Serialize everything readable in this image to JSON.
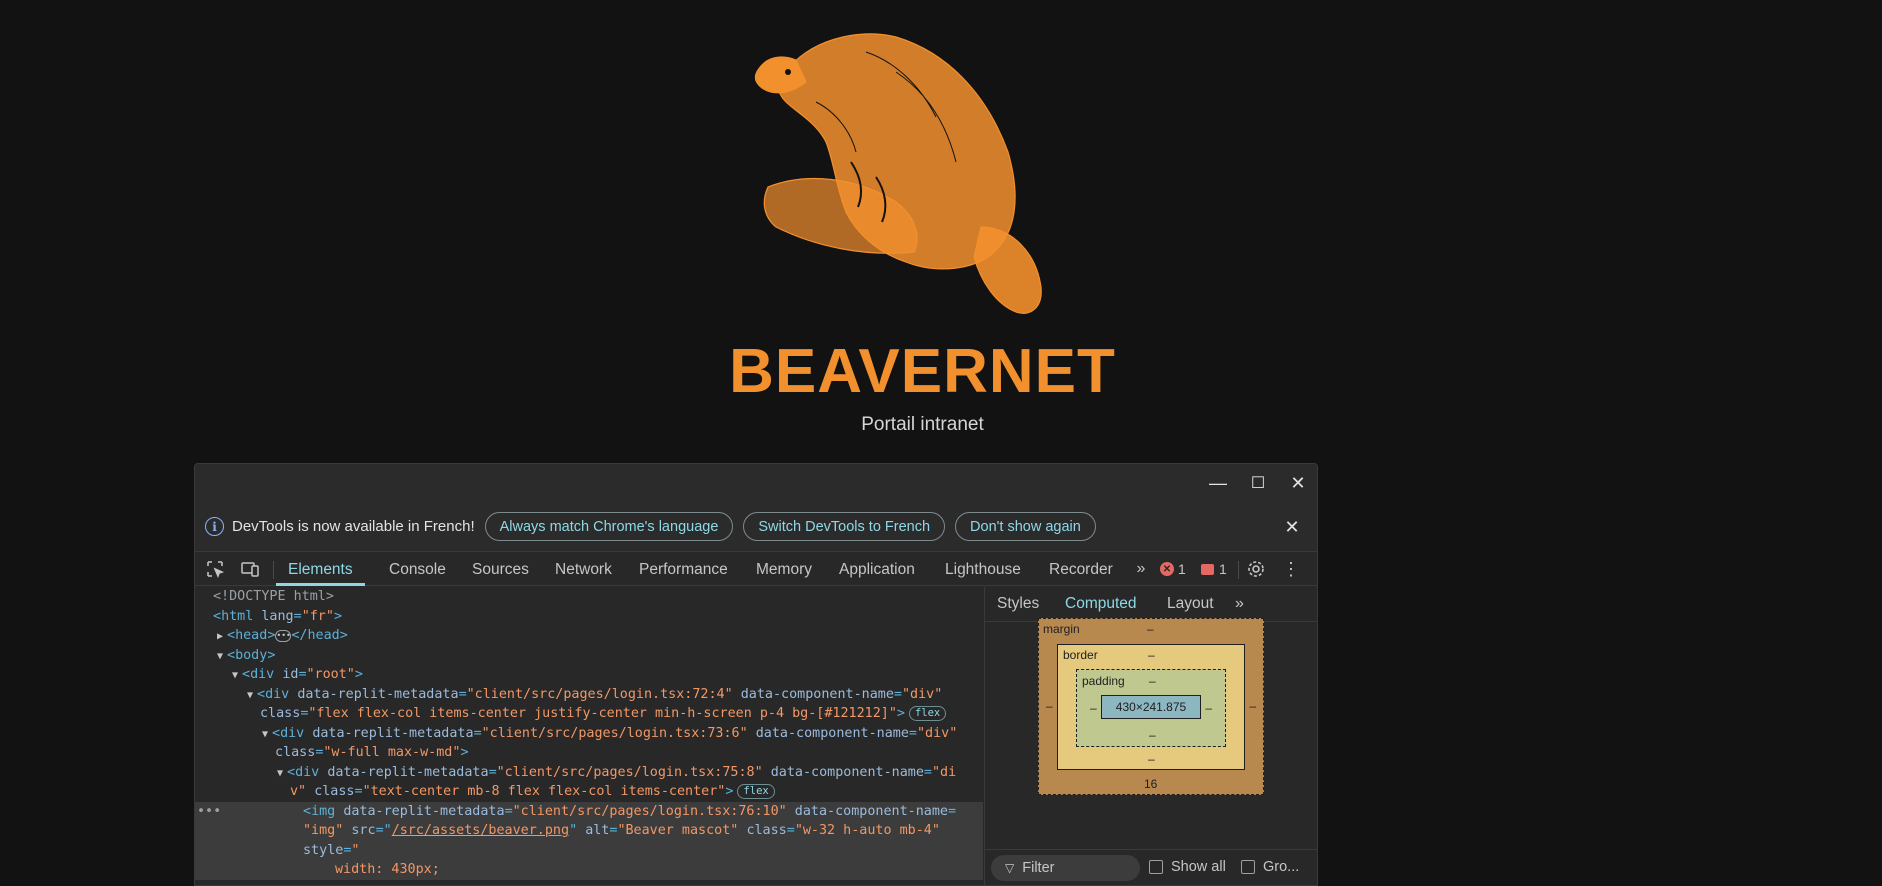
{
  "app": {
    "title": "BEAVERNET",
    "subtitle": "Portail intranet",
    "accent": "#f3902e"
  },
  "window_controls": {
    "minimize": "—",
    "maximize": "☐",
    "close": "✕"
  },
  "infobar": {
    "text": "DevTools is now available in French!",
    "btn_match": "Always match Chrome's language",
    "btn_switch": "Switch DevTools to French",
    "btn_dont": "Don't show again"
  },
  "tabs": [
    "Elements",
    "Console",
    "Sources",
    "Network",
    "Performance",
    "Memory",
    "Application",
    "Lighthouse",
    "Recorder"
  ],
  "badges": {
    "errors": "1",
    "issues": "1"
  },
  "dom": {
    "l1": "<!DOCTYPE html>",
    "html_tag": "html",
    "lang_attr": "lang",
    "lang_val": "\"fr\"",
    "head": "head",
    "body": "body",
    "div": "div",
    "id_attr": "id",
    "root_val": "\"root\"",
    "meta_attr": "data-replit-metadata",
    "comp_attr": "data-component-name",
    "class_attr": "class",
    "d1_meta": "\"client/src/pages/login.tsx:72:4\"",
    "d1_comp": "\"div\"",
    "d1_class": "\"flex flex-col items-center justify-center min-h-screen p-4 bg-[#121212]\"",
    "d2_meta": "\"client/src/pages/login.tsx:73:6\"",
    "d2_comp": "\"div\"",
    "d2_class": "\"w-full max-w-md\"",
    "d3_meta": "\"client/src/pages/login.tsx:75:8\"",
    "d3_comp_a": "\"di",
    "d3_comp_b": "v\"",
    "d3_class": "\"text-center mb-8 flex flex-col items-center\"",
    "img_tag": "img",
    "img_meta": "\"client/src/pages/login.tsx:76:10\"",
    "img_comp": "\"img\"",
    "src_attr": "src",
    "src_val": "/src/assets/beaver.png",
    "alt_attr": "alt",
    "alt_val": "\"Beaver mascot\"",
    "img_class": "\"w-32 h-auto mb-4\"",
    "style_attr": "style",
    "style_open": "\"",
    "style_width": "width: 430px;",
    "flex_badge": "flex",
    "ellipsis": "•••",
    "row_dots": "•••"
  },
  "right_panel": {
    "tabs": [
      "Styles",
      "Computed",
      "Layout"
    ],
    "box": {
      "margin": "margin",
      "border": "border",
      "padding": "padding",
      "content": "430×241.875",
      "dash": "–",
      "margin_bottom": "16"
    },
    "filter": "Filter",
    "show_all": "Show all",
    "group": "Gro..."
  }
}
